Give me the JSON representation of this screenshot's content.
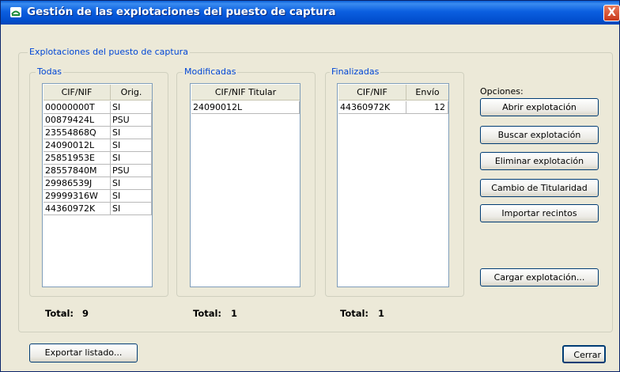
{
  "window": {
    "title": "Gestión de las explotaciones del puesto de captura",
    "close_label": "X"
  },
  "main_group": {
    "label": "Explotaciones del puesto de captura"
  },
  "todas": {
    "label": "Todas",
    "columns": [
      "CIF/NIF",
      "Orig."
    ],
    "rows": [
      [
        "00000000T",
        "SI"
      ],
      [
        "00879424L",
        "PSU"
      ],
      [
        "23554868Q",
        "SI"
      ],
      [
        "24090012L",
        "SI"
      ],
      [
        "25851953E",
        "SI"
      ],
      [
        "28557840M",
        "PSU"
      ],
      [
        "29986539J",
        "SI"
      ],
      [
        "29999316W",
        "SI"
      ],
      [
        "44360972K",
        "SI"
      ]
    ],
    "total_label": "Total:",
    "total_value": "9"
  },
  "modificadas": {
    "label": "Modificadas",
    "columns": [
      "CIF/NIF Titular"
    ],
    "rows": [
      [
        "24090012L"
      ]
    ],
    "total_label": "Total:",
    "total_value": "1"
  },
  "finalizadas": {
    "label": "Finalizadas",
    "columns": [
      "CIF/NIF",
      "Envío"
    ],
    "rows": [
      [
        "44360972K",
        "12"
      ]
    ],
    "total_label": "Total:",
    "total_value": "1"
  },
  "options": {
    "label": "Opciones:",
    "buttons": [
      "Abrir explotación",
      "Buscar explotación",
      "Eliminar explotación",
      "Cambio de Titularidad",
      "Importar recintos"
    ],
    "load_button": "Cargar explotación..."
  },
  "footer": {
    "export_button": "Exportar listado...",
    "close_button": "Cerrar"
  }
}
